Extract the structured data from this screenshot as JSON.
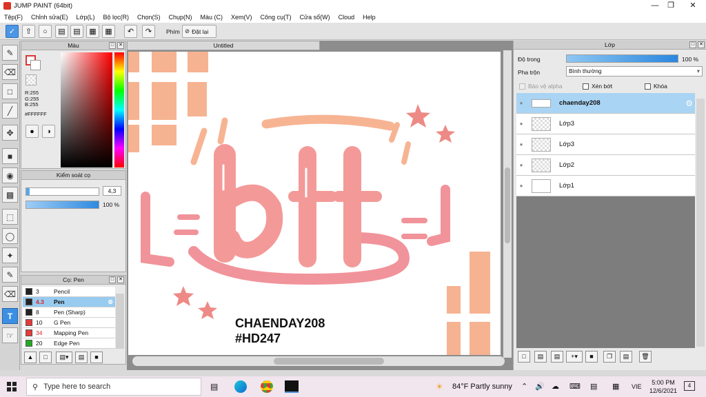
{
  "window": {
    "title": "JUMP PAINT (64bit)"
  },
  "menu": [
    "Tệp(F)",
    "Chỉnh sửa(E)",
    "Lớp(L)",
    "Bộ lọc(R)",
    "Chọn(S)",
    "Chụp(N)",
    "Màu (C)",
    "Xem(V)",
    "Công cụ(T)",
    "Cửa sổ(W)",
    "Cloud",
    "Help"
  ],
  "toolbar": {
    "key_label": "Phím",
    "reset_label": "Đặt lại"
  },
  "color_panel": {
    "title": "Màu",
    "r": "R:255",
    "g": "G:255",
    "b": "B:255",
    "hex": "#FFFFFF"
  },
  "brush_control": {
    "title": "Kiểm soát cọ",
    "size": "4,3",
    "opacity": "100 %"
  },
  "brush_panel": {
    "title": "Cọ: Pen",
    "items": [
      {
        "size": "3",
        "name": "Pencil",
        "color": "#222222"
      },
      {
        "size": "4.3",
        "name": "Pen",
        "color": "#222222"
      },
      {
        "size": "8",
        "name": "Pen (Sharp)",
        "color": "#222222"
      },
      {
        "size": "10",
        "name": "G Pen",
        "color": "#e53b3b"
      },
      {
        "size": "34",
        "name": "Mapping Pen",
        "color": "#e53b3b"
      },
      {
        "size": "20",
        "name": "Edge Pen",
        "color": "#22aa22"
      }
    ]
  },
  "document": {
    "tab": "Untitled",
    "signature_line1": "CHAENDAY208",
    "signature_line2": "#HD247",
    "artwork_text": "bff"
  },
  "layers_panel": {
    "title": "Lớp",
    "opacity_label": "Độ trong",
    "opacity_value": "100 %",
    "opacity_fraction": 1.0,
    "blend_label": "Pha trộn",
    "blend_value": "Bình thường",
    "protect_alpha": "Bảo vệ alpha",
    "clip": "Xén bớt",
    "lock": "Khóa",
    "layers": [
      {
        "name": "chaenday208",
        "selected": true
      },
      {
        "name": "Lớp3",
        "selected": false
      },
      {
        "name": "Lớp3",
        "selected": false
      },
      {
        "name": "Lớp2",
        "selected": false
      },
      {
        "name": "Lớp1",
        "selected": false
      }
    ]
  },
  "taskbar": {
    "search_placeholder": "Type here to search",
    "weather": "84°F  Partly sunny",
    "lang": "VIE",
    "time": "5:00 PM",
    "date": "12/6/2021",
    "notif_count": "4"
  }
}
